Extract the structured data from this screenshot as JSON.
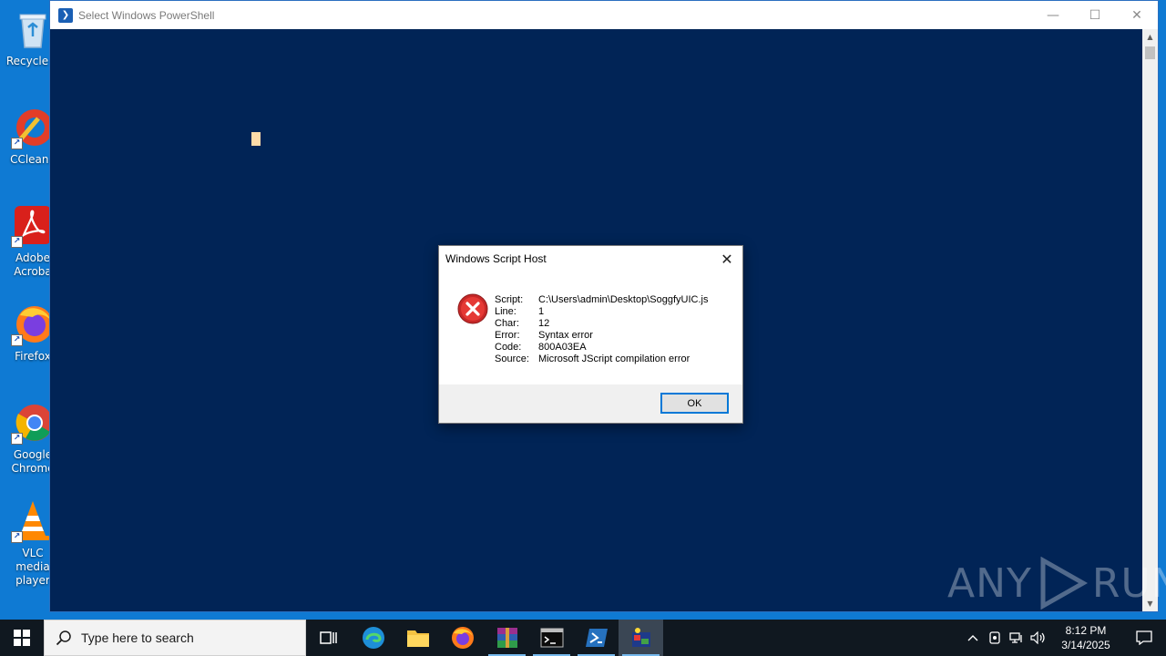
{
  "desktop": {
    "icons": [
      {
        "label": "Recycle B"
      },
      {
        "label": "CCleane"
      },
      {
        "label": "Adobe Acroba"
      },
      {
        "label": "Firefox"
      },
      {
        "label": "Google Chrome"
      },
      {
        "label": "VLC media player"
      }
    ]
  },
  "powershell": {
    "title": "Select Windows PowerShell",
    "controls": {
      "minimize": "—",
      "maximize": "☐",
      "close": "✕"
    }
  },
  "dialog": {
    "title": "Windows Script Host",
    "close_glyph": "✕",
    "rows": [
      {
        "label": "Script:",
        "value": "C:\\Users\\admin\\Desktop\\SoggfyUIC.js"
      },
      {
        "label": "Line:",
        "value": "1"
      },
      {
        "label": "Char:",
        "value": "12"
      },
      {
        "label": "Error:",
        "value": "Syntax error"
      },
      {
        "label": "Code:",
        "value": "800A03EA"
      },
      {
        "label": "Source:",
        "value": "Microsoft JScript compilation error"
      }
    ],
    "ok_label": "OK",
    "error_color": "#d32f2f"
  },
  "watermark": {
    "left": "ANY",
    "right": "RUN"
  },
  "taskbar": {
    "search_placeholder": "Type here to search",
    "items": [
      "task-view-icon",
      "edge-icon",
      "file-explorer-icon",
      "firefox-icon",
      "winrar-icon",
      "cmd-icon",
      "powershell-icon",
      "script-host-icon"
    ],
    "clock": {
      "time": "8:12 PM",
      "date": "3/14/2025"
    }
  },
  "colors": {
    "desktop": "#0f7ad3",
    "powershell_bg": "#012456",
    "cursor": "#fedba9",
    "taskbar": "#101820",
    "accent": "#0078d7"
  }
}
